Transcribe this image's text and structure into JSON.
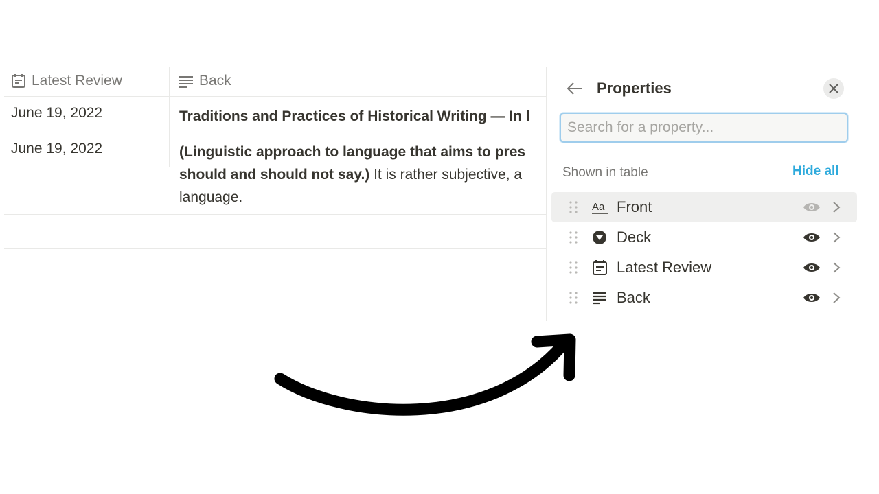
{
  "table": {
    "columns": [
      {
        "label": "Latest Review",
        "icon": "calendar-icon"
      },
      {
        "label": "Back",
        "icon": "text-lines-icon"
      }
    ],
    "rows": [
      {
        "date": "June 19, 2022",
        "back_bold": "Traditions and Practices of Historical Writing — In l"
      },
      {
        "date": "June 19, 2022",
        "back_line1_bold": "(Linguistic approach to language that aims to pres",
        "back_line2_bold": "should and should not say.)",
        "back_line2_rest": " It is rather subjective, a",
        "back_line3": "language."
      }
    ]
  },
  "panel": {
    "title": "Properties",
    "search_placeholder": "Search for a property...",
    "section_label": "Shown in table",
    "hide_all": "Hide all",
    "properties": [
      {
        "label": "Front",
        "icon": "text-aa-icon",
        "visible": true,
        "highlighted": true
      },
      {
        "label": "Deck",
        "icon": "select-circle-icon",
        "visible": true
      },
      {
        "label": "Latest Review",
        "icon": "calendar-icon",
        "visible": true
      },
      {
        "label": "Back",
        "icon": "text-lines-icon",
        "visible": true
      }
    ]
  },
  "colors": {
    "text": "#37352f",
    "muted": "#787774",
    "accent": "#2eaadc",
    "highlight": "#efefee",
    "eye_dim": "#b6b5b2"
  }
}
